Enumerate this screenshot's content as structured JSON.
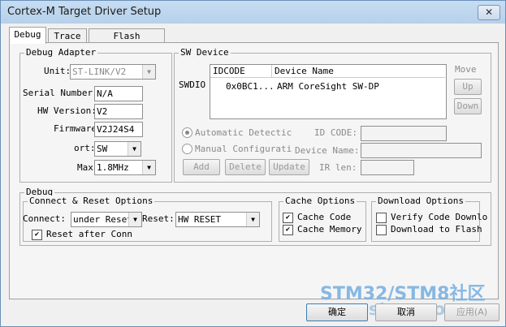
{
  "window": {
    "title": "Cortex-M Target Driver Setup",
    "close_glyph": "✕"
  },
  "tabs": [
    "Debug",
    "Trace",
    "Flash Download"
  ],
  "debug_adapter": {
    "title": "Debug Adapter",
    "unit_label": "Unit:",
    "unit_value": "ST-LINK/V2",
    "serial_label": "Serial Number:",
    "serial_value": "N/A",
    "hw_label": "HW Version:",
    "hw_value": "V2",
    "fw_label": "Firmware",
    "fw_value": "V2J24S4",
    "port_label": "ort:",
    "port_value": "SW",
    "max_label": "Max",
    "max_value": "1.8MHz"
  },
  "sw_device": {
    "title": "SW Device",
    "swdio_label": "SWDIO",
    "col_idcode": "IDCODE",
    "col_name": "Device Name",
    "row_idcode": "0x0BC1...",
    "row_name": "ARM CoreSight SW-DP",
    "move_label": "Move",
    "up_label": "Up",
    "down_label": "Down",
    "auto_label": "Automatic Detectic",
    "manual_label": "Manual Configurati",
    "idcode_label": "ID CODE:",
    "devname_label": "Device Name:",
    "irlen_label": "IR len:",
    "add_label": "Add",
    "delete_label": "Delete",
    "update_label": "Update"
  },
  "debug": {
    "title": "Debug",
    "connect_reset": {
      "title": "Connect & Reset Options",
      "connect_label": "Connect:",
      "connect_value": "under Reset",
      "reset_label": "Reset:",
      "reset_value": "HW RESET",
      "reset_after_label": "Reset after Conn"
    },
    "cache": {
      "title": "Cache Options",
      "code_label": "Cache Code",
      "memory_label": "Cache Memory"
    },
    "download": {
      "title": "Download Options",
      "verify_label": "Verify Code Downlo",
      "flash_label": "Download to Flash"
    }
  },
  "footer": {
    "ok_label": "确定",
    "cancel_label": "取消",
    "apply_label": "应用(A)"
  },
  "watermark": {
    "line1": "STM32/STM8社区",
    "line2": "www.stmcu.org.cn"
  },
  "colors": {
    "accent": "#3399ff"
  }
}
